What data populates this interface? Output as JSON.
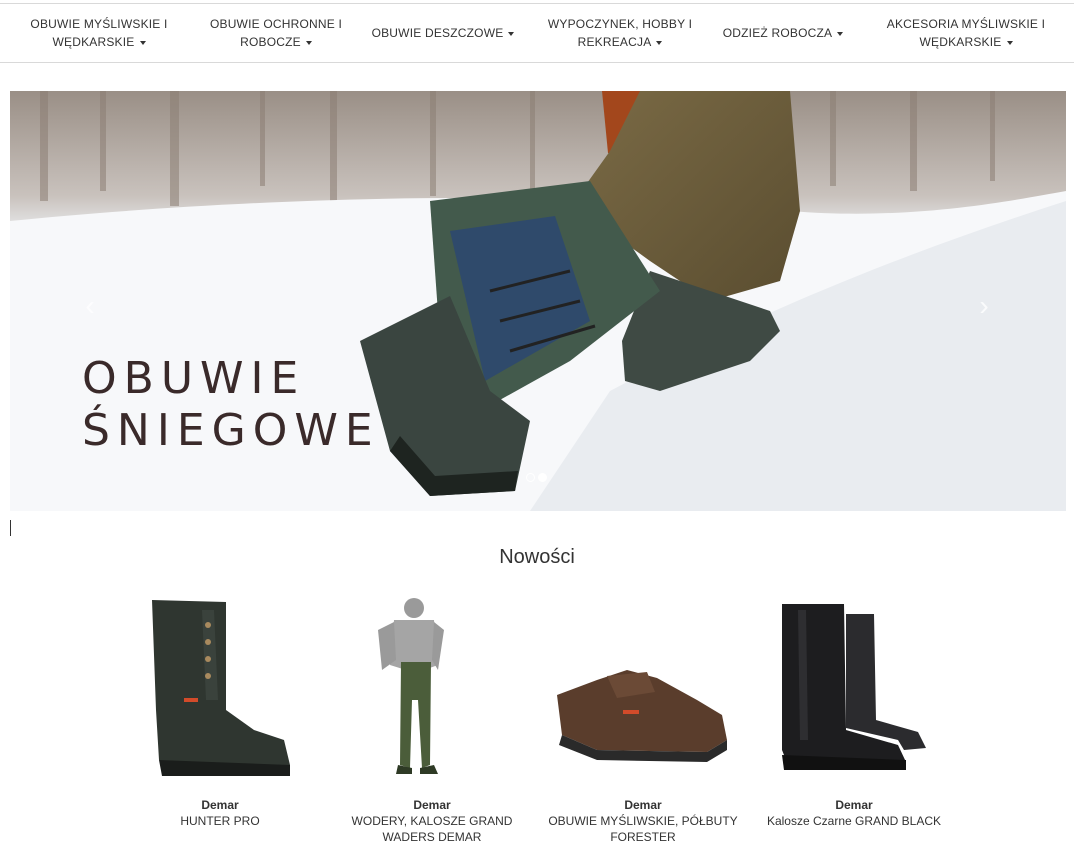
{
  "nav": {
    "items": [
      {
        "label_line1": "OBUWIE MYŚLIWSKIE I",
        "label_line2": "WĘDKARSKIE"
      },
      {
        "label_line1": "OBUWIE OCHRONNE I",
        "label_line2": "ROBOCZE"
      },
      {
        "label_line1": "OBUWIE DESZCZOWE",
        "label_line2": ""
      },
      {
        "label_line1": "WYPOCZYNEK, HOBBY I",
        "label_line2": "REKREACJA"
      },
      {
        "label_line1": "ODZIEŻ ROBOCZA",
        "label_line2": ""
      },
      {
        "label_line1": "AKCESORIA MYŚLIWSKIE I",
        "label_line2": "WĘDKARSKIE"
      }
    ]
  },
  "hero": {
    "title_line1": "OBUWIE",
    "title_line2": "ŚNIEGOWE",
    "prev_arrow": "‹",
    "next_arrow": "›",
    "slide_count": 2,
    "active_slide": 2
  },
  "news": {
    "title": "Nowości",
    "products": [
      {
        "brand": "Demar",
        "name": "HUNTER PRO"
      },
      {
        "brand": "Demar",
        "name": "WODERY, KALOSZE GRAND WADERS DEMAR"
      },
      {
        "brand": "Demar",
        "name": "OBUWIE MYŚLIWSKIE, PÓŁBUTY FORESTER"
      },
      {
        "brand": "Demar",
        "name": "Kalosze Czarne GRAND BLACK"
      }
    ]
  },
  "colors": {
    "text": "#333333",
    "border": "#d9d9d9",
    "hero_title": "#3a2a2a"
  }
}
